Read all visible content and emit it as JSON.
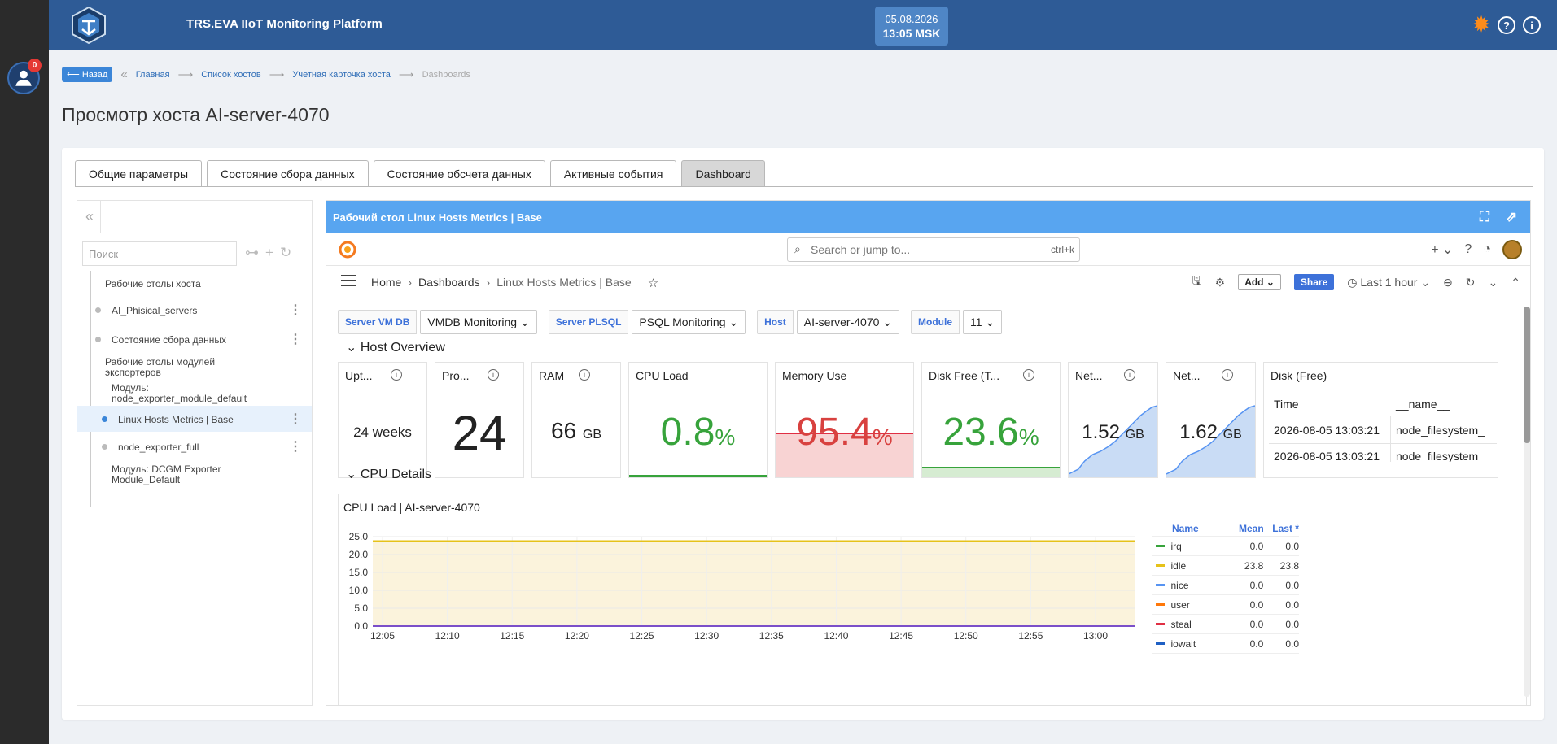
{
  "app": {
    "title": "TRS.EVA IIoT Monitoring Platform",
    "date": "05.08.2026",
    "time": "13:05 MSK",
    "notif_count": "0"
  },
  "breadcrumb": {
    "back": "⟵ Назад",
    "items": [
      "Главная",
      "Список хостов",
      "Учетная карточка хоста",
      "Dashboards"
    ]
  },
  "page_title": "Просмотр хоста AI-server-4070",
  "tabs": [
    "Общие параметры",
    "Состояние сбора данных",
    "Состояние обсчета данных",
    "Активные события",
    "Dashboard"
  ],
  "tree": {
    "search_placeholder": "Поиск",
    "items": [
      {
        "label": "Рабочие столы хоста"
      },
      {
        "label": "AI_Phisical_servers"
      },
      {
        "label": "Состояние сбора данных"
      },
      {
        "label": "Рабочие столы модулей экспортеров"
      },
      {
        "label": "Модуль: node_exporter_module_default"
      },
      {
        "label": "Linux Hosts Metrics | Base"
      },
      {
        "label": "node_exporter_full"
      },
      {
        "label": "Модуль: DCGM Exporter Module_Default"
      }
    ]
  },
  "panel": {
    "title": "Рабочий стол Linux Hosts Metrics | Base"
  },
  "grafana": {
    "search_placeholder": "Search or jump to...",
    "shortcut": "ctrl+k",
    "crumbs": [
      "Home",
      "Dashboards",
      "Linux Hosts Metrics | Base"
    ],
    "add_label": "Add",
    "share_label": "Share",
    "time_range": "Last 1 hour",
    "vars": [
      {
        "label": "Server VM DB",
        "value": "VMDB Monitoring"
      },
      {
        "label": "Server PLSQL",
        "value": "PSQL Monitoring"
      },
      {
        "label": "Host",
        "value": "AI-server-4070"
      },
      {
        "label": "Module",
        "value": "11"
      }
    ],
    "row_host": "Host Overview",
    "row_cpu": "CPU Details",
    "stats": {
      "uptime": {
        "title": "Upt...",
        "value": "24 weeks"
      },
      "procs": {
        "title": "Pro...",
        "value": "24"
      },
      "ram": {
        "title": "RAM",
        "value": "66",
        "unit": "GB"
      },
      "cpu": {
        "title": "CPU Load",
        "value": "0.8",
        "unit": "%"
      },
      "mem": {
        "title": "Memory Use",
        "value": "95.4",
        "unit": "%"
      },
      "disk": {
        "title": "Disk Free (T...",
        "value": "23.6",
        "unit": "%"
      },
      "net1": {
        "title": "Net...",
        "value": "1.52",
        "unit": "GB"
      },
      "net2": {
        "title": "Net...",
        "value": "1.62",
        "unit": "GB"
      }
    },
    "disk_table": {
      "title": "Disk (Free)",
      "headers": [
        "Time",
        "__name__"
      ],
      "rows": [
        [
          "2026-08-05 13:03:21",
          "node_filesystem_"
        ],
        [
          "2026-08-05 13:03:21",
          "node_filesystem_"
        ]
      ]
    },
    "legend": {
      "headers": [
        "Name",
        "Mean",
        "Last *"
      ],
      "rows": [
        {
          "name": "irq",
          "mean": "0.0",
          "last": "0.0",
          "color": "#37a33b"
        },
        {
          "name": "idle",
          "mean": "23.8",
          "last": "23.8",
          "color": "#e6c21a"
        },
        {
          "name": "nice",
          "mean": "0.0",
          "last": "0.0",
          "color": "#5794f2"
        },
        {
          "name": "user",
          "mean": "0.0",
          "last": "0.0",
          "color": "#ff780a"
        },
        {
          "name": "steal",
          "mean": "0.0",
          "last": "0.0",
          "color": "#e02f44"
        },
        {
          "name": "iowait",
          "mean": "0.0",
          "last": "0.0",
          "color": "#1f60c4"
        }
      ]
    }
  },
  "chart_data": {
    "type": "line",
    "title": "CPU Load | AI-server-4070",
    "xlabel": "",
    "ylabel": "",
    "x": [
      "12:05",
      "12:10",
      "12:15",
      "12:20",
      "12:25",
      "12:30",
      "12:35",
      "12:40",
      "12:45",
      "12:50",
      "12:55",
      "13:00"
    ],
    "yticks": [
      "25.0",
      "20.0",
      "15.0",
      "10.0",
      "5.0",
      "0.0"
    ],
    "ylim": [
      0,
      25
    ],
    "series": [
      {
        "name": "irq",
        "values": [
          0,
          0,
          0,
          0,
          0,
          0,
          0,
          0,
          0,
          0,
          0,
          0
        ],
        "color": "#37a33b"
      },
      {
        "name": "idle",
        "values": [
          23.8,
          23.8,
          23.8,
          23.8,
          23.8,
          23.8,
          23.8,
          23.8,
          23.8,
          23.8,
          23.8,
          23.8
        ],
        "color": "#e6c21a"
      },
      {
        "name": "nice",
        "values": [
          0,
          0,
          0,
          0,
          0,
          0,
          0,
          0,
          0,
          0,
          0,
          0
        ],
        "color": "#5794f2"
      },
      {
        "name": "user",
        "values": [
          0,
          0,
          0,
          0,
          0,
          0,
          0,
          0,
          0,
          0,
          0,
          0
        ],
        "color": "#ff780a"
      },
      {
        "name": "steal",
        "values": [
          0,
          0,
          0,
          0,
          0,
          0,
          0,
          0,
          0,
          0,
          0,
          0
        ],
        "color": "#e02f44"
      },
      {
        "name": "iowait",
        "values": [
          0,
          0,
          0,
          0,
          0,
          0,
          0,
          0,
          0,
          0,
          0,
          0
        ],
        "color": "#1f60c4"
      }
    ],
    "grid": true,
    "legend": "right"
  }
}
